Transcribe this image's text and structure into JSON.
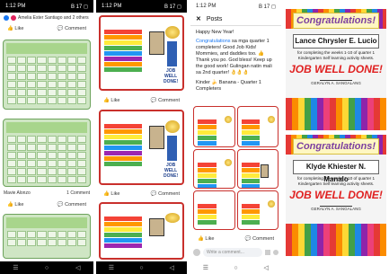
{
  "status": {
    "time": "1:12 PM",
    "right": "B 17 ◻"
  },
  "panel1": {
    "header": "Amelia Ester Santiago and 2 others",
    "like": "Like",
    "comment": "Comment",
    "footer_left": "Mavie Alonzo",
    "footer_right": "1 Comment"
  },
  "panel2": {
    "like": "Like",
    "comment": "Comment",
    "done_label": "JOB WELL DONE!"
  },
  "panel3": {
    "back_icon": "close-icon",
    "title": "Posts",
    "greeting": "Happy New Year!",
    "body_highlight": "Congratulations",
    "body": " sa mga quarter 1 completers! Good Job Kids! Mommies, and daddies too. 👍 Thank you po. God bless! Keep up the good work! Gulingan natin mali sa 2nd quarter! 👌👌👌",
    "album_line": "Kinder 🍌 Banana - Quarter 1 Completers",
    "like": "Like",
    "comment": "Comment",
    "comment_placeholder": "Write a comment..."
  },
  "panel4": {
    "cards": [
      {
        "banner": "Congratulations!",
        "name": "Lance Chrysler E. Lucio",
        "sub": "for completing the weeks 1-10 of quarter 1 Kindergarten Self learning activity sheets.",
        "done": "JOB WELL DONE!",
        "signer": "GERALYN A. SANGALANG"
      },
      {
        "banner": "Congratulations!",
        "name": "Klyde Khiester N. Manalo",
        "sub": "for completing the weeks 1-10 of quarter 1 Kindergarten Self learning activity sheets.",
        "done": "JOB WELL DONE!",
        "signer": "GERALYN A. SANGALANG"
      }
    ]
  },
  "nav": {
    "recent": "☰",
    "home": "○",
    "back": "◁"
  },
  "colors": {
    "fb_blue": "#1877f2",
    "report_red": "#c9302c",
    "grid_green": "#cfe6c4"
  }
}
